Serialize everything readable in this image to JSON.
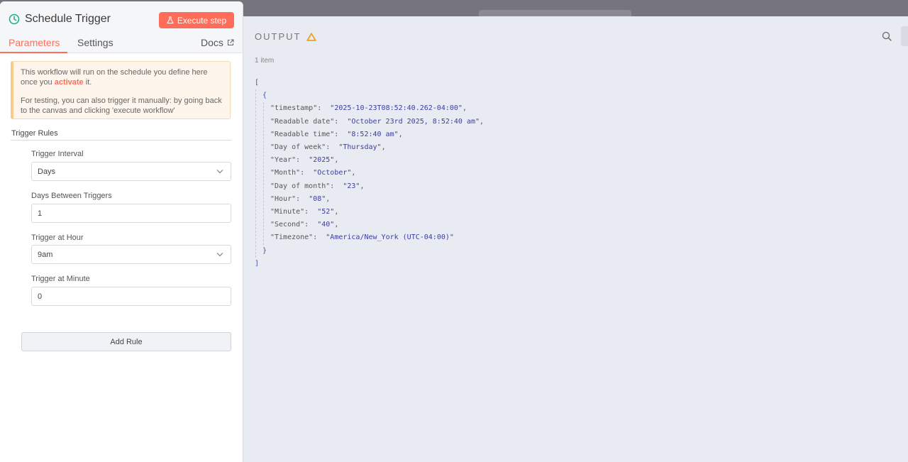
{
  "node": {
    "title": "Schedule Trigger",
    "execute_label": "Execute step",
    "tabs": [
      "Parameters",
      "Settings"
    ],
    "docs_label": "Docs"
  },
  "notice": {
    "line1_before": "This workflow will run on the schedule you define here once you ",
    "line1_link": "activate",
    "line1_after": " it.",
    "line2": "For testing, you can also trigger it manually: by going back to the canvas and clicking 'execute workflow'"
  },
  "rules": {
    "section_title": "Trigger Rules",
    "interval_label": "Trigger Interval",
    "interval_value": "Days",
    "days_label": "Days Between Triggers",
    "days_value": "1",
    "hour_label": "Trigger at Hour",
    "hour_value": "9am",
    "minute_label": "Trigger at Minute",
    "minute_value": "0",
    "add_rule_label": "Add Rule"
  },
  "output": {
    "title": "OUTPUT",
    "item_count": "1 item",
    "open_bracket": "[",
    "close_bracket": "]",
    "open_brace": "{",
    "close_brace": "}",
    "entries": [
      {
        "key": "\"timestamp\":",
        "value": "\"2025-10-23T08:52:40.262-04:00\"",
        "comma": ","
      },
      {
        "key": "\"Readable date\":",
        "value": "\"October 23rd 2025, 8:52:40 am\"",
        "comma": ","
      },
      {
        "key": "\"Readable time\":",
        "value": "\"8:52:40 am\"",
        "comma": ","
      },
      {
        "key": "\"Day of week\":",
        "value": "\"Thursday\"",
        "comma": ","
      },
      {
        "key": "\"Year\":",
        "value": "\"2025\"",
        "comma": ","
      },
      {
        "key": "\"Month\":",
        "value": "\"October\"",
        "comma": ","
      },
      {
        "key": "\"Day of month\":",
        "value": "\"23\"",
        "comma": ","
      },
      {
        "key": "\"Hour\":",
        "value": "\"08\"",
        "comma": ","
      },
      {
        "key": "\"Minute\":",
        "value": "\"52\"",
        "comma": ","
      },
      {
        "key": "\"Second\":",
        "value": "\"40\"",
        "comma": ","
      },
      {
        "key": "\"Timezone\":",
        "value": "\"America/New_York (UTC-04:00)\"",
        "comma": ""
      }
    ]
  },
  "colors": {
    "accent": "#ff6d5a",
    "trigger_icon": "#27ae8f",
    "warning": "#f0a020"
  },
  "icons": [
    "clock-icon",
    "flask-icon",
    "external-link-icon",
    "chevron-down-icon",
    "warning-icon",
    "search-icon"
  ]
}
